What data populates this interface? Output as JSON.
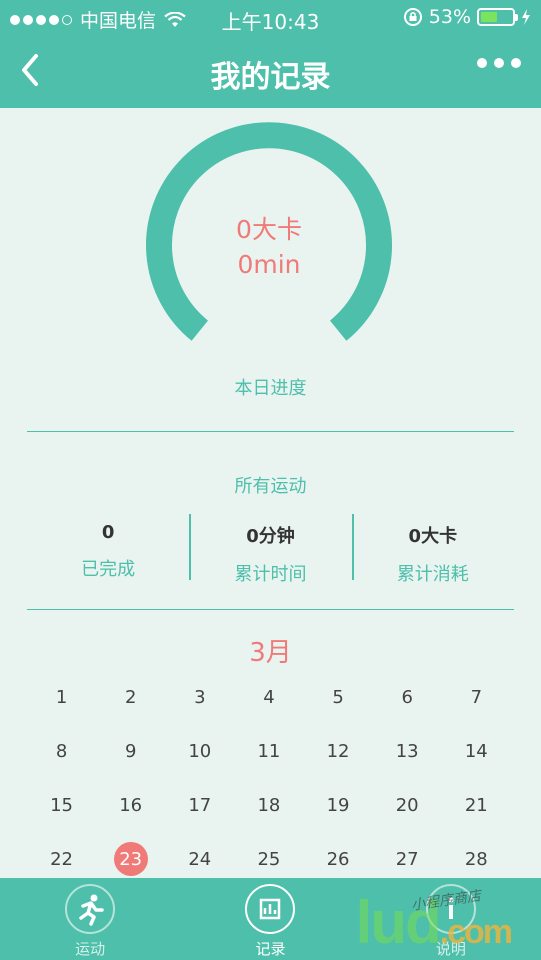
{
  "status_bar": {
    "carrier": "中国电信",
    "time": "上午10:43",
    "battery_percent": "53%",
    "battery_level": 0.53,
    "signal_dots_filled": 4,
    "signal_dots_total": 5
  },
  "nav": {
    "title": "我的记录",
    "back_icon": "chevron-left-icon",
    "more_icon": "more-dots-icon"
  },
  "progress": {
    "kcal": "0大卡",
    "minutes": "0min",
    "label": "本日进度"
  },
  "all_sports": {
    "title": "所有运动",
    "stats": [
      {
        "value": "0",
        "label": "已完成"
      },
      {
        "value": "0分钟",
        "label": "累计时间"
      },
      {
        "value": "0大卡",
        "label": "累计消耗"
      }
    ]
  },
  "calendar": {
    "month": "3月",
    "weeks": [
      [
        "1",
        "2",
        "3",
        "4",
        "5",
        "6",
        "7"
      ],
      [
        "8",
        "9",
        "10",
        "11",
        "12",
        "13",
        "14"
      ],
      [
        "15",
        "16",
        "17",
        "18",
        "19",
        "20",
        "21"
      ],
      [
        "22",
        "23",
        "24",
        "25",
        "26",
        "27",
        "28"
      ]
    ],
    "today": "23"
  },
  "tabbar": {
    "items": [
      {
        "label": "运动",
        "icon": "running-icon"
      },
      {
        "label": "记录",
        "icon": "chart-icon"
      },
      {
        "label": "说明",
        "icon": "info-icon"
      }
    ],
    "active_index": 1
  },
  "colors": {
    "primary": "#4dbfaa",
    "accent": "#f07a78",
    "background": "#e9f4f1"
  },
  "watermark": {
    "main": "lud",
    "suffix": ".com",
    "sub": "小程序商店"
  }
}
